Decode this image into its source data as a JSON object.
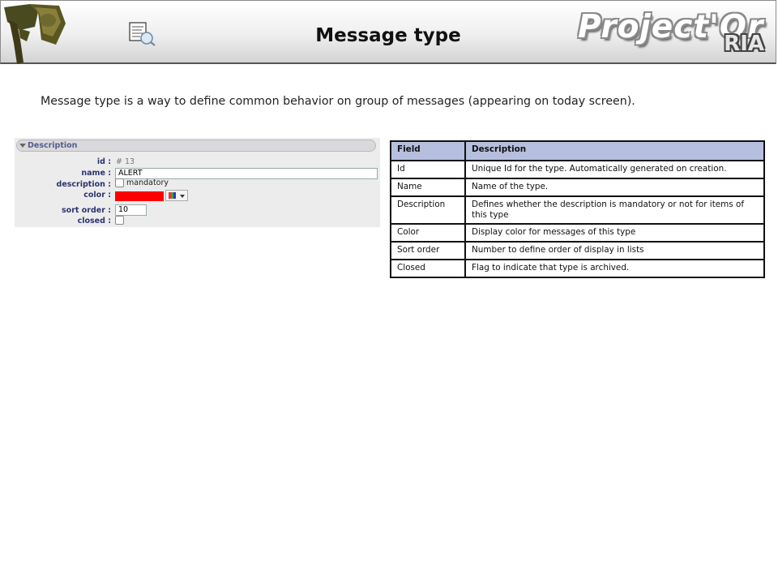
{
  "header": {
    "title": "Message type",
    "brand_main": "Project'Or",
    "brand_sub": "RIA",
    "icons": [
      "projector-logo-icon",
      "document-search-icon"
    ]
  },
  "intro": "Message type is a way to define common behavior on group of messages (appearing on today screen).",
  "form": {
    "section_title": "Description",
    "labels": {
      "id": "id :",
      "name": "name :",
      "description": "description :",
      "color": "color :",
      "sort_order": "sort order :",
      "closed": "closed :"
    },
    "id_value": "# 13",
    "name_value": "ALERT",
    "mandatory_label": "mandatory",
    "color_value": "#ff0000",
    "sort_order_value": "10"
  },
  "table": {
    "headers": [
      "Field",
      "Description"
    ],
    "rows": [
      [
        "Id",
        "Unique Id for the type. Automatically generated on creation."
      ],
      [
        "Name",
        "Name of the type."
      ],
      [
        "Description",
        "Defines whether the description is mandatory or not for items of this type"
      ],
      [
        "Color",
        "Display color for messages of this type"
      ],
      [
        "Sort order",
        "Number to define order of display in lists"
      ],
      [
        "Closed",
        "Flag to indicate that type is archived."
      ]
    ]
  },
  "colors": {
    "table_header": "#b7bfdf",
    "form_label": "#2e3470",
    "color_swatch": "#ff0000"
  }
}
